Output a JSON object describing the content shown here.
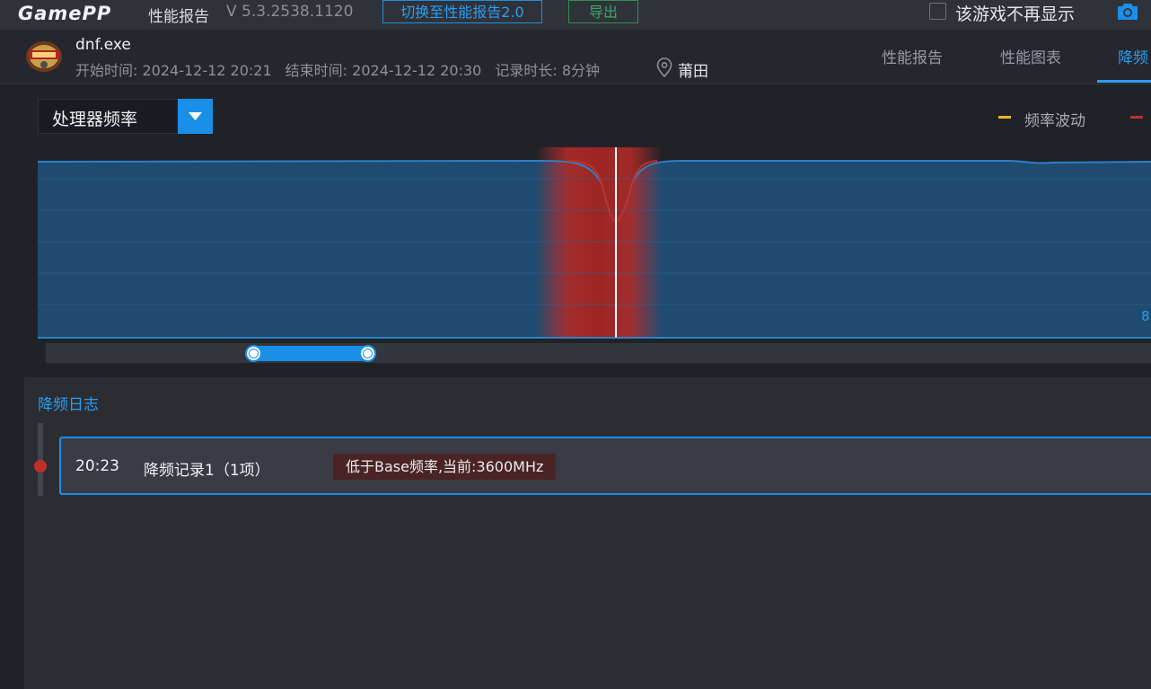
{
  "app": {
    "logo": "GamePP",
    "report_title": "性能报告",
    "version": "V 5.3.2538.1120",
    "switch_button": "切换至性能报告2.0",
    "export_button": "导出",
    "hide_game_label": "该游戏不再显示",
    "camera_icon": "camera-icon"
  },
  "session": {
    "game_name": "dnf.exe",
    "start_time": "开始时间: 2024-12-12 20:21",
    "end_time": "结束时间: 2024-12-12 20:30",
    "duration": "记录时长: 8分钟",
    "location": "莆田"
  },
  "tabs": [
    {
      "label": "性能报告",
      "active": false
    },
    {
      "label": "性能图表",
      "active": false
    },
    {
      "label": "降频",
      "active": true
    }
  ],
  "metric_select": {
    "selected": "处理器频率"
  },
  "legend": [
    {
      "label": "频率波动",
      "color": "#f0b428"
    },
    {
      "label": "",
      "color": "#c0302b"
    }
  ],
  "chart": {
    "axis_value": "8",
    "fill_color": "#1f4b70",
    "line_color": "#2f7fc6",
    "throttle_color": "#c0302b"
  },
  "log": {
    "title": "降频日志",
    "entries": [
      {
        "time": "20:23",
        "record": "降频记录1（1项）",
        "badge": "低于Base频率,当前:3600MHz"
      }
    ]
  }
}
